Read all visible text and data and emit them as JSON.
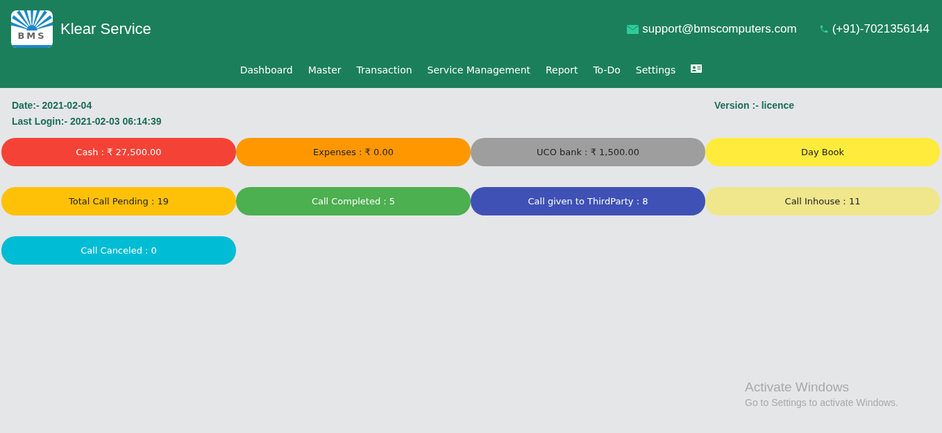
{
  "header": {
    "logo_text": "BMS",
    "app_name": "Klear Service",
    "email": "support@bmscomputers.com",
    "phone": "(+91)-7021356144"
  },
  "nav": {
    "items": [
      "Dashboard",
      "Master",
      "Transaction",
      "Service Management",
      "Report",
      "To-Do",
      "Settings"
    ]
  },
  "info": {
    "date": "Date:- 2021-02-04",
    "last_login": "Last Login:- 2021-02-03 06:14:39",
    "version": "Version :- licence"
  },
  "tiles": [
    {
      "label": "Cash : ₹ 27,500.00",
      "color": "#f44336"
    },
    {
      "label": "Expenses : ₹ 0.00",
      "color": "#ff9800"
    },
    {
      "label": "UCO bank : ₹ 1,500.00",
      "color": "#9e9e9e"
    },
    {
      "label": "Day Book",
      "color": "#ffeb3b"
    },
    {
      "label": "Total Call Pending : 19",
      "color": "#ffc107"
    },
    {
      "label": "Call Completed : 5",
      "color": "#4caf50"
    },
    {
      "label": "Call given to ThirdParty : 8",
      "color": "#3f51b5"
    },
    {
      "label": "Call Inhouse : 11",
      "color": "#f0e68c"
    },
    {
      "label": "Call Canceled : 0",
      "color": "#00bcd4"
    }
  ],
  "os_notice": {
    "title": "Activate Windows",
    "text": "Go to Settings to activate Windows."
  }
}
